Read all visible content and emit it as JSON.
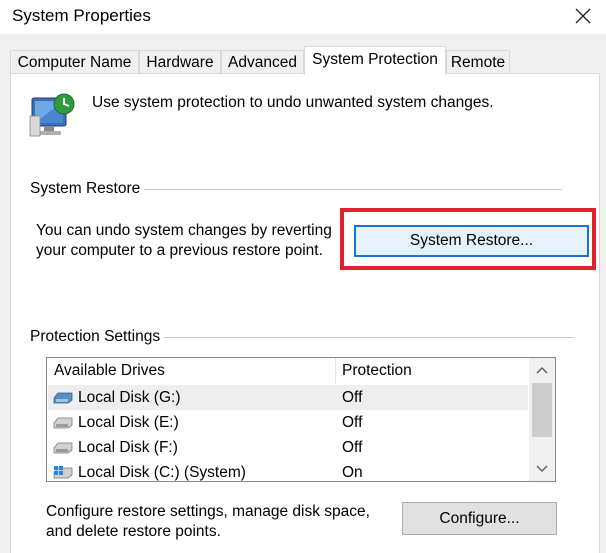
{
  "window": {
    "title": "System Properties",
    "close_icon": "close-icon"
  },
  "tabs": [
    {
      "label": "Computer Name",
      "active": false
    },
    {
      "label": "Hardware",
      "active": false
    },
    {
      "label": "Advanced",
      "active": false
    },
    {
      "label": "System Protection",
      "active": true
    },
    {
      "label": "Remote",
      "active": false
    }
  ],
  "intro": {
    "icon": "system-protection-icon",
    "text": "Use system protection to undo unwanted system changes."
  },
  "system_restore": {
    "group_label": "System Restore",
    "description_line1": "You can undo system changes by reverting",
    "description_line2": "your computer to a previous restore point.",
    "button_label": "System Restore...",
    "highlight_color": "#e0202a"
  },
  "protection": {
    "group_label": "Protection Settings",
    "columns": [
      "Available Drives",
      "Protection"
    ],
    "drives": [
      {
        "name": "Local Disk (G:)",
        "protection": "Off",
        "icon": "removable-drive-icon",
        "selected": true
      },
      {
        "name": "Local Disk (E:)",
        "protection": "Off",
        "icon": "hard-drive-icon",
        "selected": false
      },
      {
        "name": "Local Disk (F:)",
        "protection": "Off",
        "icon": "hard-drive-icon",
        "selected": false
      },
      {
        "name": "Local Disk (C:) (System)",
        "protection": "On",
        "icon": "system-drive-icon",
        "selected": false
      }
    ],
    "configure_line1": "Configure restore settings, manage disk space,",
    "configure_line2": "and delete restore points.",
    "configure_button": "Configure..."
  }
}
